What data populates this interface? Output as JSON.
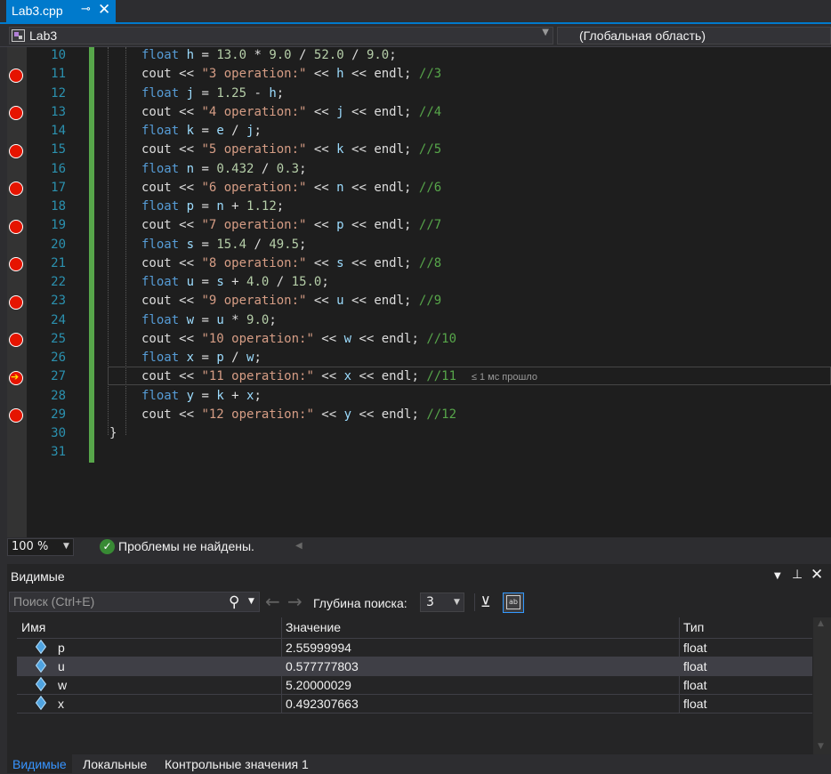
{
  "tab": {
    "label": "Lab3.cpp",
    "pin_glyph": "⊸",
    "close_glyph": "✕"
  },
  "navbar": {
    "project": "Lab3",
    "scope": "(Глобальная область)"
  },
  "editor": {
    "lines": [
      {
        "n": "10",
        "bp": false,
        "segments": [
          [
            "kw",
            "float "
          ],
          [
            "var",
            "h"
          ],
          [
            "t",
            " = "
          ],
          [
            "num",
            "13.0"
          ],
          [
            "t",
            " * "
          ],
          [
            "num",
            "9.0"
          ],
          [
            "t",
            " / "
          ],
          [
            "num",
            "52.0"
          ],
          [
            "t",
            " / "
          ],
          [
            "num",
            "9.0"
          ],
          [
            "t",
            ";"
          ]
        ]
      },
      {
        "n": "11",
        "bp": true,
        "segments": [
          [
            "t",
            "cout << "
          ],
          [
            "str",
            "\"3 operation:\""
          ],
          [
            "t",
            " << "
          ],
          [
            "var",
            "h"
          ],
          [
            "t",
            " << endl; "
          ],
          [
            "cmt",
            "//3"
          ]
        ]
      },
      {
        "n": "12",
        "bp": false,
        "segments": [
          [
            "kw",
            "float "
          ],
          [
            "var",
            "j"
          ],
          [
            "t",
            " = "
          ],
          [
            "num",
            "1.25"
          ],
          [
            "t",
            " - "
          ],
          [
            "var",
            "h"
          ],
          [
            "t",
            ";"
          ]
        ]
      },
      {
        "n": "13",
        "bp": true,
        "segments": [
          [
            "t",
            "cout << "
          ],
          [
            "str",
            "\"4 operation:\""
          ],
          [
            "t",
            " << "
          ],
          [
            "var",
            "j"
          ],
          [
            "t",
            " << endl; "
          ],
          [
            "cmt",
            "//4"
          ]
        ]
      },
      {
        "n": "14",
        "bp": false,
        "segments": [
          [
            "kw",
            "float "
          ],
          [
            "var",
            "k"
          ],
          [
            "t",
            " = "
          ],
          [
            "var",
            "e"
          ],
          [
            "t",
            " / "
          ],
          [
            "var",
            "j"
          ],
          [
            "t",
            ";"
          ]
        ]
      },
      {
        "n": "15",
        "bp": true,
        "segments": [
          [
            "t",
            "cout << "
          ],
          [
            "str",
            "\"5 operation:\""
          ],
          [
            "t",
            " << "
          ],
          [
            "var",
            "k"
          ],
          [
            "t",
            " << endl; "
          ],
          [
            "cmt",
            "//5"
          ]
        ]
      },
      {
        "n": "16",
        "bp": false,
        "segments": [
          [
            "kw",
            "float "
          ],
          [
            "var",
            "n"
          ],
          [
            "t",
            " = "
          ],
          [
            "num",
            "0.432"
          ],
          [
            "t",
            " / "
          ],
          [
            "num",
            "0.3"
          ],
          [
            "t",
            ";"
          ]
        ]
      },
      {
        "n": "17",
        "bp": true,
        "segments": [
          [
            "t",
            "cout << "
          ],
          [
            "str",
            "\"6 operation:\""
          ],
          [
            "t",
            " << "
          ],
          [
            "var",
            "n"
          ],
          [
            "t",
            " << endl; "
          ],
          [
            "cmt",
            "//6"
          ]
        ]
      },
      {
        "n": "18",
        "bp": false,
        "segments": [
          [
            "kw",
            "float "
          ],
          [
            "var",
            "p"
          ],
          [
            "t",
            " = "
          ],
          [
            "var",
            "n"
          ],
          [
            "t",
            " + "
          ],
          [
            "num",
            "1.12"
          ],
          [
            "t",
            ";"
          ]
        ]
      },
      {
        "n": "19",
        "bp": true,
        "segments": [
          [
            "t",
            "cout << "
          ],
          [
            "str",
            "\"7 operation:\""
          ],
          [
            "t",
            " << "
          ],
          [
            "var",
            "p"
          ],
          [
            "t",
            " << endl; "
          ],
          [
            "cmt",
            "//7"
          ]
        ]
      },
      {
        "n": "20",
        "bp": false,
        "segments": [
          [
            "kw",
            "float "
          ],
          [
            "var",
            "s"
          ],
          [
            "t",
            " = "
          ],
          [
            "num",
            "15.4"
          ],
          [
            "t",
            " / "
          ],
          [
            "num",
            "49.5"
          ],
          [
            "t",
            ";"
          ]
        ]
      },
      {
        "n": "21",
        "bp": true,
        "segments": [
          [
            "t",
            "cout << "
          ],
          [
            "str",
            "\"8 operation:\""
          ],
          [
            "t",
            " << "
          ],
          [
            "var",
            "s"
          ],
          [
            "t",
            " << endl; "
          ],
          [
            "cmt",
            "//8"
          ]
        ]
      },
      {
        "n": "22",
        "bp": false,
        "segments": [
          [
            "kw",
            "float "
          ],
          [
            "var",
            "u"
          ],
          [
            "t",
            " = "
          ],
          [
            "var",
            "s"
          ],
          [
            "t",
            " + "
          ],
          [
            "num",
            "4.0"
          ],
          [
            "t",
            " / "
          ],
          [
            "num",
            "15.0"
          ],
          [
            "t",
            ";"
          ]
        ]
      },
      {
        "n": "23",
        "bp": true,
        "segments": [
          [
            "t",
            "cout << "
          ],
          [
            "str",
            "\"9 operation:\""
          ],
          [
            "t",
            " << "
          ],
          [
            "var",
            "u"
          ],
          [
            "t",
            " << endl; "
          ],
          [
            "cmt",
            "//9"
          ]
        ]
      },
      {
        "n": "24",
        "bp": false,
        "segments": [
          [
            "kw",
            "float "
          ],
          [
            "var",
            "w"
          ],
          [
            "t",
            " = "
          ],
          [
            "var",
            "u"
          ],
          [
            "t",
            " * "
          ],
          [
            "num",
            "9.0"
          ],
          [
            "t",
            ";"
          ]
        ]
      },
      {
        "n": "25",
        "bp": true,
        "segments": [
          [
            "t",
            "cout << "
          ],
          [
            "str",
            "\"10 operation:\""
          ],
          [
            "t",
            " << "
          ],
          [
            "var",
            "w"
          ],
          [
            "t",
            " << endl; "
          ],
          [
            "cmt",
            "//10"
          ]
        ]
      },
      {
        "n": "26",
        "bp": false,
        "segments": [
          [
            "kw",
            "float "
          ],
          [
            "var",
            "x"
          ],
          [
            "t",
            " = "
          ],
          [
            "var",
            "p"
          ],
          [
            "t",
            " / "
          ],
          [
            "var",
            "w"
          ],
          [
            "t",
            ";"
          ]
        ]
      },
      {
        "n": "27",
        "bp": "current",
        "segments": [
          [
            "t",
            "cout << "
          ],
          [
            "str",
            "\"11 operation:\""
          ],
          [
            "t",
            " << "
          ],
          [
            "var",
            "x"
          ],
          [
            "t",
            " << endl; "
          ],
          [
            "cmt",
            "//11"
          ],
          [
            "t",
            "  "
          ],
          [
            "tip",
            "≤ 1 мс прошло"
          ]
        ]
      },
      {
        "n": "28",
        "bp": false,
        "segments": [
          [
            "kw",
            "float "
          ],
          [
            "var",
            "y"
          ],
          [
            "t",
            " = "
          ],
          [
            "var",
            "k"
          ],
          [
            "t",
            " + "
          ],
          [
            "var",
            "x"
          ],
          [
            "t",
            ";"
          ]
        ]
      },
      {
        "n": "29",
        "bp": true,
        "segments": [
          [
            "t",
            "cout << "
          ],
          [
            "str",
            "\"12 operation:\""
          ],
          [
            "t",
            " << "
          ],
          [
            "var",
            "y"
          ],
          [
            "t",
            " << endl; "
          ],
          [
            "cmt",
            "//12"
          ]
        ]
      },
      {
        "n": "30",
        "bp": false,
        "segments": [
          [
            "t",
            "}"
          ]
        ]
      },
      {
        "n": "31",
        "bp": false,
        "segments": []
      }
    ]
  },
  "editor_status": {
    "zoom": "100 %",
    "problems": "Проблемы не найдены.",
    "ok_glyph": "✓"
  },
  "autos": {
    "title": "Видимые",
    "search_placeholder": "Поиск (Ctrl+E)",
    "depth_label": "Глубина поиска:",
    "depth_value": "3",
    "columns": {
      "name": "Имя",
      "value": "Значение",
      "type": "Тип"
    },
    "rows": [
      {
        "name": "p",
        "value": "2.55999994",
        "type": "float",
        "selected": false
      },
      {
        "name": "u",
        "value": "0.577777803",
        "type": "float",
        "selected": true
      },
      {
        "name": "w",
        "value": "5.20000029",
        "type": "float",
        "selected": false
      },
      {
        "name": "x",
        "value": "0.492307663",
        "type": "float",
        "selected": false
      }
    ]
  },
  "bottom_tabs": [
    {
      "label": "Видимые",
      "active": true
    },
    {
      "label": "Локальные",
      "active": false
    },
    {
      "label": "Контрольные значения 1",
      "active": false
    }
  ],
  "colors": {
    "accent": "#007acc",
    "breakpoint": "#e51400",
    "keyword": "#569cd6",
    "string": "#d69d85",
    "comment": "#57a64a",
    "line_number": "#2b91af"
  }
}
